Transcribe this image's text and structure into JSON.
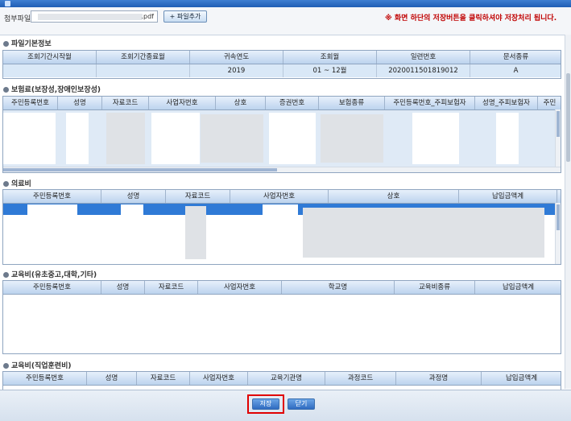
{
  "toolbar": {
    "attach_label": "첨부파일",
    "file_ext": ".pdf",
    "add_file_label": "+ 파일추가",
    "notice": "※ 화면 하단의 저장버튼을 클릭하셔야 저장처리 됩니다."
  },
  "sections": {
    "basic": {
      "title": "파일기본정보",
      "columns": [
        "조회기간시작월",
        "조회기간종료월",
        "귀속연도",
        "조회월",
        "일련번호",
        "문서종류"
      ],
      "row": [
        "",
        "",
        "2019",
        "01 ~ 12월",
        "2020011501819012",
        "A"
      ]
    },
    "insurance": {
      "title": "보험료(보장성,장애인보장성)",
      "columns": [
        "주민등록번호",
        "성명",
        "자료코드",
        "사업자번호",
        "상호",
        "증권번호",
        "보험종류",
        "주민등록번호_주피보험자",
        "성명_주피보험자",
        "주민"
      ]
    },
    "medical": {
      "title": "의료비",
      "columns": [
        "주민등록번호",
        "성명",
        "자료코드",
        "사업자번호",
        "상호",
        "납입금액계"
      ]
    },
    "education": {
      "title": "교육비(유초중고,대학,기타)",
      "columns": [
        "주민등록번호",
        "성명",
        "자료코드",
        "사업자번호",
        "학교명",
        "교육비종류",
        "납입금액계"
      ]
    },
    "vocational": {
      "title": "교육비(직업훈련비)",
      "columns": [
        "주민등록번호",
        "성명",
        "자료코드",
        "사업자번호",
        "교육기관명",
        "과정코드",
        "과정명",
        "납입금액계"
      ]
    }
  },
  "footer": {
    "save_label": "저장",
    "close_label": "닫기"
  }
}
